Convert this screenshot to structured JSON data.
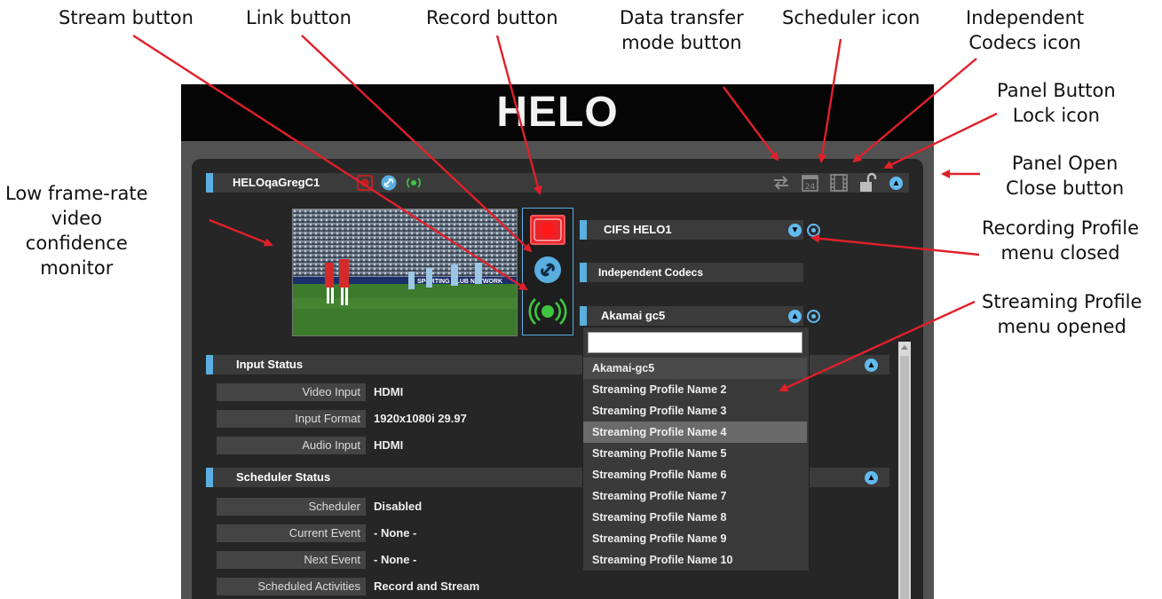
{
  "annotations": {
    "stream_button": "Stream button",
    "link_button": "Link button",
    "record_button": "Record button",
    "data_transfer_line1": "Data transfer",
    "data_transfer_line2": "mode button",
    "scheduler_icon": "Scheduler icon",
    "independent_codecs_line1": "Independent",
    "independent_codecs_line2": "Codecs icon",
    "panel_lock_line1": "Panel Button",
    "panel_lock_line2": "Lock icon",
    "panel_open_line1": "Panel Open",
    "panel_open_line2": "Close button",
    "low_frame_line1": "Low frame-rate",
    "low_frame_line2": "video",
    "low_frame_line3": "confidence",
    "low_frame_line4": "monitor",
    "recording_menu_line1": "Recording Profile",
    "recording_menu_line2": "menu closed",
    "streaming_menu_line1": "Streaming Profile",
    "streaming_menu_line2": "menu opened"
  },
  "app": {
    "title": "HELO",
    "device_name": "HELOqaGregC1",
    "scheduler_date": "24",
    "video_overlay_text": "SPORTING CLUB NETWORK",
    "recording_profile": "CIFS HELO1",
    "codec_mode": "Independent Codecs",
    "streaming_profile": "Akamai gc5",
    "search_value": "",
    "streaming_options": [
      "Akamai-gc5",
      "Streaming Profile Name 2",
      "Streaming Profile Name 3",
      "Streaming Profile Name 4",
      "Streaming Profile Name 5",
      "Streaming Profile Name 6",
      "Streaming Profile Name 7",
      "Streaming Profile Name 8",
      "Streaming Profile Name 9",
      "Streaming Profile Name 10"
    ],
    "highlighted_option": "Streaming Profile Name 4",
    "input_status": {
      "title": "Input Status",
      "rows": [
        {
          "label": "Video Input",
          "value": "HDMI"
        },
        {
          "label": "Input Format",
          "value": "1920x1080i 29.97"
        },
        {
          "label": "Audio Input",
          "value": "HDMI"
        }
      ]
    },
    "scheduler_status": {
      "title": "Scheduler Status",
      "rows": [
        {
          "label": "Scheduler",
          "value": "Disabled"
        },
        {
          "label": "Current Event",
          "value": "- None -"
        },
        {
          "label": "Next Event",
          "value": "- None -"
        },
        {
          "label": "Scheduled Activities",
          "value": "Record and Stream"
        }
      ]
    }
  },
  "colors": {
    "accent": "#5aaee0",
    "record_red": "#e8242b",
    "stream_green": "#3fc63f",
    "arrow_red": "#e0202a"
  },
  "icons": [
    "record-icon",
    "link-icon",
    "stream-icon",
    "transfer-icon",
    "calendar-icon",
    "film-icon",
    "lock-icon",
    "chevron-up-icon",
    "chevron-down-icon",
    "gear-icon"
  ]
}
